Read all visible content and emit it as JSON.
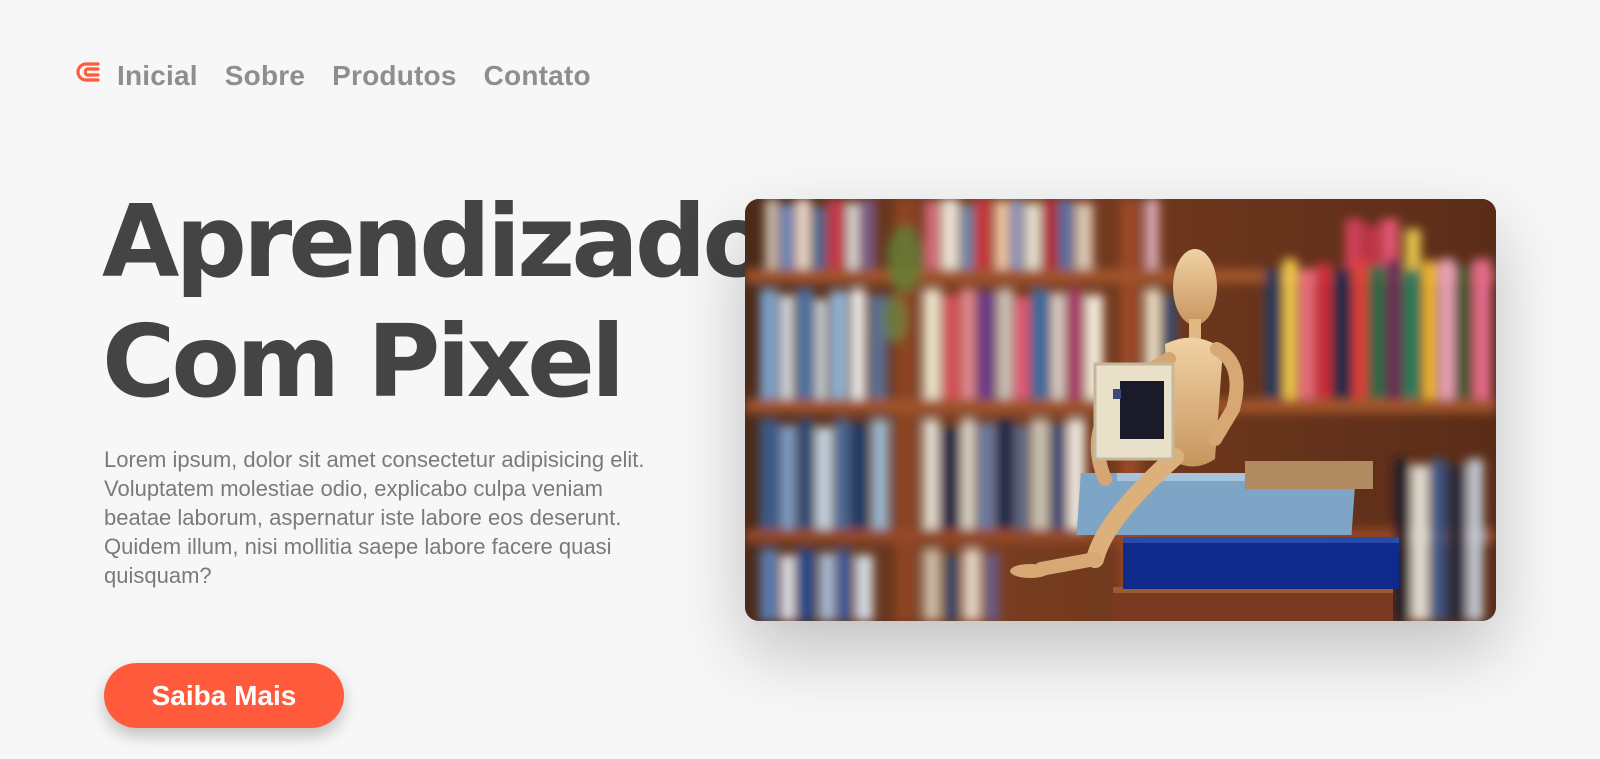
{
  "nav": {
    "logo_icon": "brand-logo-icon",
    "items": [
      {
        "label": "Inicial"
      },
      {
        "label": "Sobre"
      },
      {
        "label": "Produtos"
      },
      {
        "label": "Contato"
      }
    ]
  },
  "hero": {
    "title_line1": "Aprendizado",
    "title_line2": "Com Pixel",
    "description": "Lorem ipsum, dolor sit amet consectetur adipisicing elit. Voluptatem molestiae odio, explicabo culpa veniam beatae laborum, aspernatur iste labore eos deserunt. Quidem illum, nisi mollitia saepe labore facere quasi quisquam?",
    "cta_label": "Saiba Mais",
    "image": "wooden-mannequin-reading-books-photo"
  },
  "colors": {
    "accent": "#ff5a3c",
    "title": "#444444",
    "nav": "#8e8e8e",
    "body_text": "#7a7a7a",
    "background": "#f7f7f7"
  }
}
